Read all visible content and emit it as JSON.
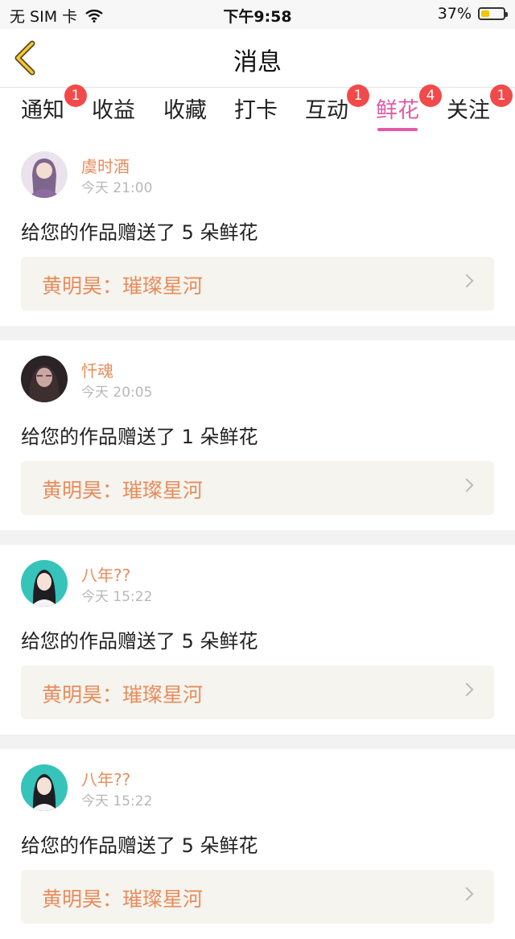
{
  "status_bar": {
    "carrier": "无 SIM 卡",
    "time": "下午9:58",
    "battery_percent": "37%",
    "battery_level": 0.37
  },
  "header": {
    "title": "消息"
  },
  "tabs": [
    {
      "label": "通知",
      "badge": "1"
    },
    {
      "label": "收益",
      "badge": ""
    },
    {
      "label": "收藏",
      "badge": ""
    },
    {
      "label": "打卡",
      "badge": ""
    },
    {
      "label": "互动",
      "badge": "1"
    },
    {
      "label": "鲜花",
      "badge": "4",
      "active": true
    },
    {
      "label": "关注",
      "badge": "1"
    }
  ],
  "messages": [
    {
      "user": "虞时酒",
      "time": "今天 21:00",
      "text": "给您的作品赠送了 5 朵鲜花",
      "work": "黄明昊：璀璨星河",
      "avatar_color": "#9c7fa8"
    },
    {
      "user": "忏魂",
      "time": "今天 20:05",
      "text": "给您的作品赠送了 1 朵鲜花",
      "work": "黄明昊：璀璨星河",
      "avatar_color": "#4a3a3a"
    },
    {
      "user": "八年??",
      "time": "今天 15:22",
      "text": "给您的作品赠送了 5 朵鲜花",
      "work": "黄明昊：璀璨星河",
      "avatar_color": "#3fbfb8"
    },
    {
      "user": "八年??",
      "time": "今天 15:22",
      "text": "给您的作品赠送了 5 朵鲜花",
      "work": "黄明昊：璀璨星河",
      "avatar_color": "#3fbfb8"
    }
  ]
}
